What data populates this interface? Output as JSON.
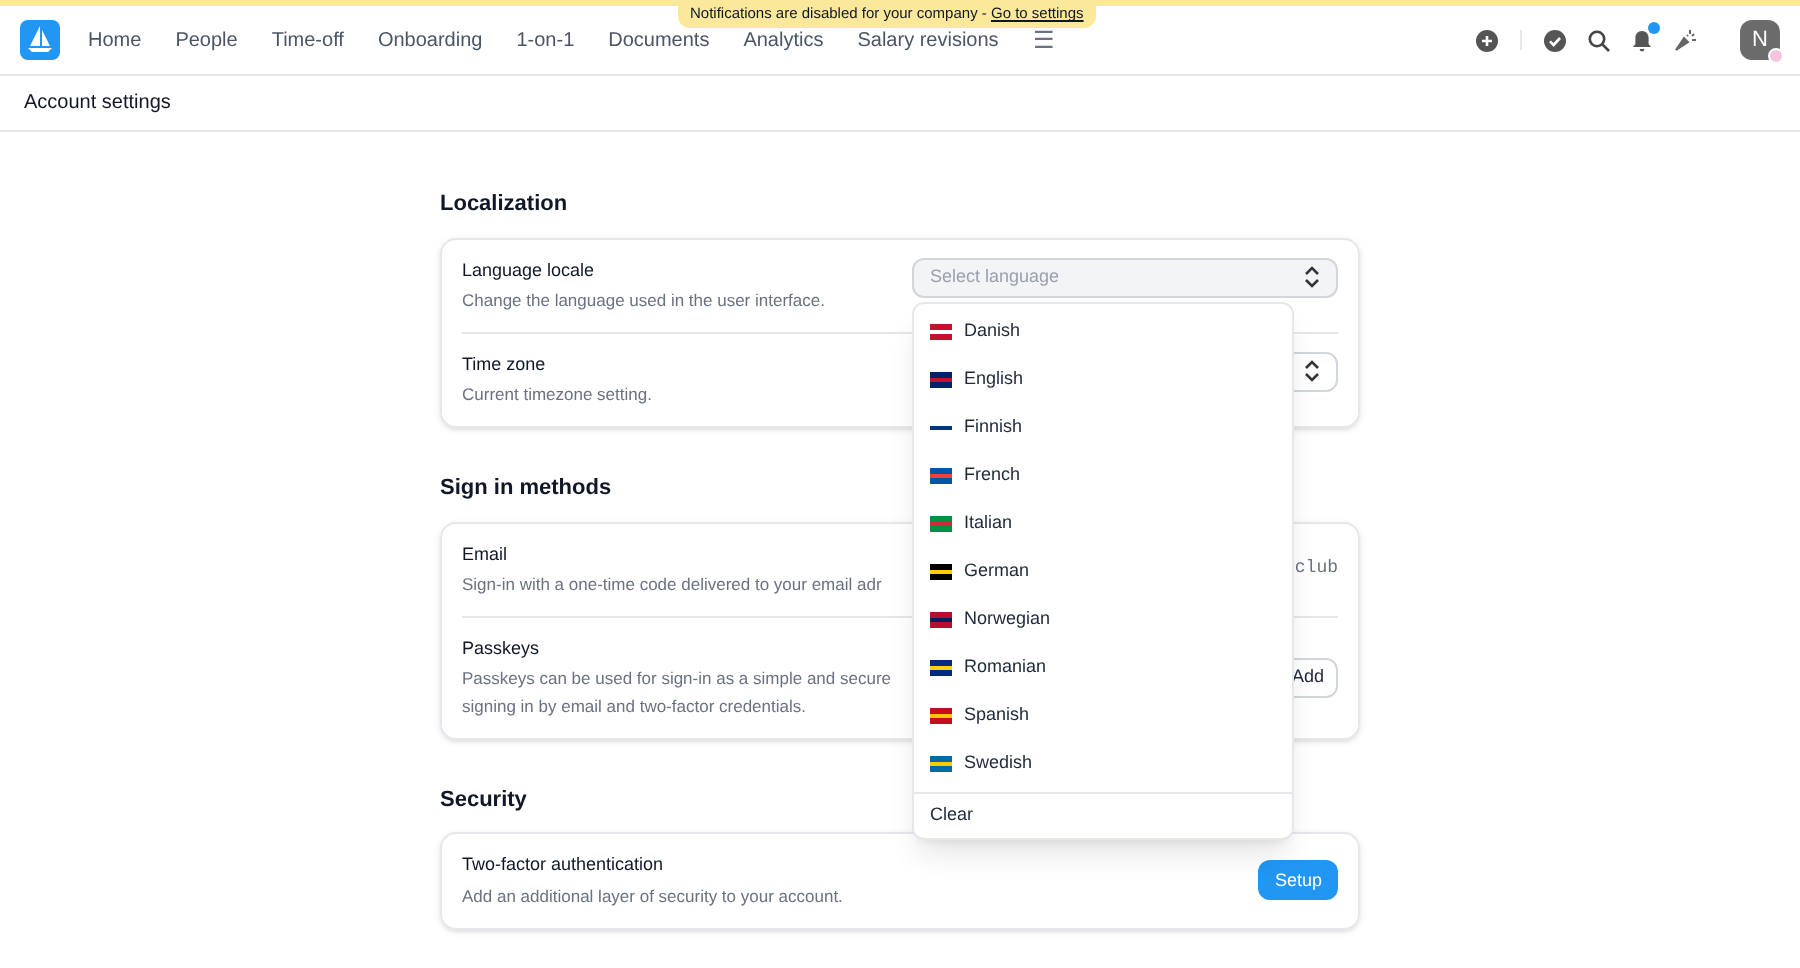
{
  "banner": {
    "text": "Notifications are disabled for your company - ",
    "link": "Go to settings"
  },
  "nav": {
    "items": [
      {
        "label": "Home",
        "selected": false
      },
      {
        "label": "People",
        "selected": false
      },
      {
        "label": "Time-off",
        "selected": false
      },
      {
        "label": "Onboarding",
        "selected": false
      },
      {
        "label": "1-on-1",
        "selected": false
      },
      {
        "label": "Documents",
        "selected": false
      },
      {
        "label": "Analytics",
        "selected": false
      },
      {
        "label": "Salary revisions",
        "selected": false
      }
    ],
    "more": "☰",
    "avatar": "N",
    "notification_dot": true
  },
  "page_title": "Account settings",
  "sections": [
    {
      "title": "Localization",
      "rows": [
        {
          "kind": "select",
          "label": "Language locale",
          "description": "Change the language used in the user interface.",
          "placeholder": "Select language",
          "open": true
        },
        {
          "kind": "select",
          "label": "Time zone",
          "description": "Current timezone setting.",
          "open": false
        }
      ]
    },
    {
      "title": "Sign in methods",
      "rows": [
        {
          "kind": "value",
          "label": "Email",
          "description": "Sign-in with a one-time code delivered to your email adr",
          "value": "club"
        },
        {
          "kind": "button",
          "label": "Passkeys",
          "description": "Passkeys can be used for sign-in as a simple and secure",
          "description_2": "signing in by email and two-factor credentials.",
          "button": "Add",
          "primary": false
        }
      ]
    },
    {
      "title": "Security",
      "rows": [
        {
          "kind": "button",
          "label": "Two-factor authentication",
          "description": "Add an additional layer of security to your account.",
          "button": "Setup",
          "primary": true
        }
      ]
    }
  ],
  "dropdown": {
    "options": [
      "Danish",
      "English",
      "Finnish",
      "French",
      "Italian",
      "German",
      "Norwegian",
      "Romanian",
      "Spanish",
      "Swedish"
    ],
    "clear": "Clear"
  }
}
